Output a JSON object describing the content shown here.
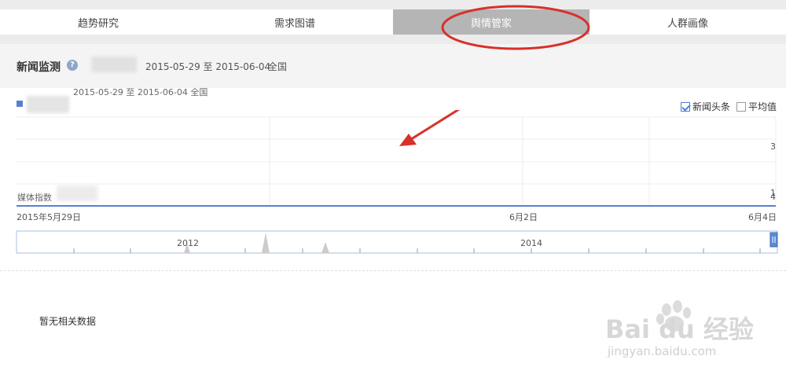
{
  "tabs": [
    {
      "label": "趋势研究",
      "active": false
    },
    {
      "label": "需求图谱",
      "active": false
    },
    {
      "label": "舆情管家",
      "active": true
    },
    {
      "label": "人群画像",
      "active": false
    }
  ],
  "panel": {
    "title": "新闻监测",
    "help_icon": "question-circle-icon",
    "date_range": "2015-05-29 至 2015-06-04",
    "region": "全国"
  },
  "chart": {
    "range_label": "2015-05-29 至 2015-06-04 全国",
    "checkboxes": [
      {
        "label": "新闻头条",
        "checked": true
      },
      {
        "label": "平均值",
        "checked": false
      }
    ],
    "y_axis_label": "媒体指数",
    "y_tick_labels": [
      "3",
      "1",
      "4"
    ],
    "x_tick_labels": [
      "2015年5月29日",
      "6月2日",
      "6月4日"
    ],
    "overview_labels": [
      "2012",
      "2014"
    ],
    "series_color": "#5b7fd0"
  },
  "chart_data": {
    "type": "line",
    "x": [
      "2015-05-29",
      "2015-05-30",
      "2015-05-31",
      "2015-06-01",
      "2015-06-02",
      "2015-06-03",
      "2015-06-04"
    ],
    "series": [
      {
        "name": "新闻头条",
        "values": [
          0,
          0,
          0,
          0,
          0,
          0,
          0
        ]
      }
    ],
    "ylabel": "媒体指数",
    "grid": true,
    "legend": "top-right"
  },
  "empty_state": "暂无相关数据",
  "watermark": {
    "text": "Bai du 经验",
    "url": "jingyan.baidu.com"
  },
  "colors": {
    "active_tab": "#b5b5b5",
    "accent": "#5b7fd0",
    "annotation_red": "#d9302a"
  }
}
